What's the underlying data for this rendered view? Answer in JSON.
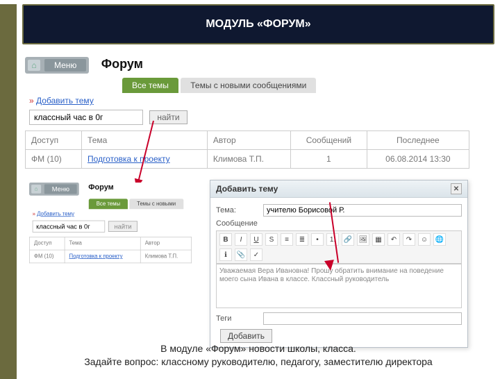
{
  "header": {
    "title": "МОДУЛЬ «ФОРУМ»"
  },
  "screenshot1": {
    "menu_label": "Меню",
    "forum_title": "Форум",
    "tab_all": "Все темы",
    "tab_new": "Темы с новыми сообщениями",
    "add_prefix": "»",
    "add_link": "Добавить тему",
    "search_value": "классный час в 0г",
    "search_btn": "найти",
    "cols": {
      "access": "Доступ",
      "topic": "Тема",
      "author": "Автор",
      "msgs": "Сообщений",
      "last": "Последнее"
    },
    "row": {
      "access": "ФМ (10)",
      "topic": "Подготовка к проекту",
      "author": "Климова Т.П.",
      "msgs": "1",
      "last": "06.08.2014 13:30"
    }
  },
  "screenshot2": {
    "menu_label": "Меню",
    "forum_title": "Форум",
    "tab_all": "Все темы",
    "tab_new": "Темы с новыми",
    "add_prefix": "»",
    "add_link": "Добавить тему",
    "search_value": "классный час в 0г",
    "search_btn": "найти",
    "cols": {
      "access": "Доступ",
      "topic": "Тема",
      "author": "Автор"
    },
    "row": {
      "access": "ФМ (10)",
      "topic": "Подготовка к проекту",
      "author": "Климова Т.П."
    }
  },
  "dialog": {
    "title": "Добавить тему",
    "field_topic": "Тема:",
    "topic_value": "учителю Борисовой Р.",
    "field_msg": "Сообщение",
    "editor_text": "Уважаемая Вера Ивановна! Прошу обратить внимание на поведение моего сына Ивана в классе. Классный руководитель",
    "field_tags": "Теги",
    "submit": "Добавить"
  },
  "caption": {
    "line1": "В модуле «Форум» новости школы, класса.",
    "line2": "Задайте вопрос: классному руководителю, педагогу, заместителю директора"
  }
}
